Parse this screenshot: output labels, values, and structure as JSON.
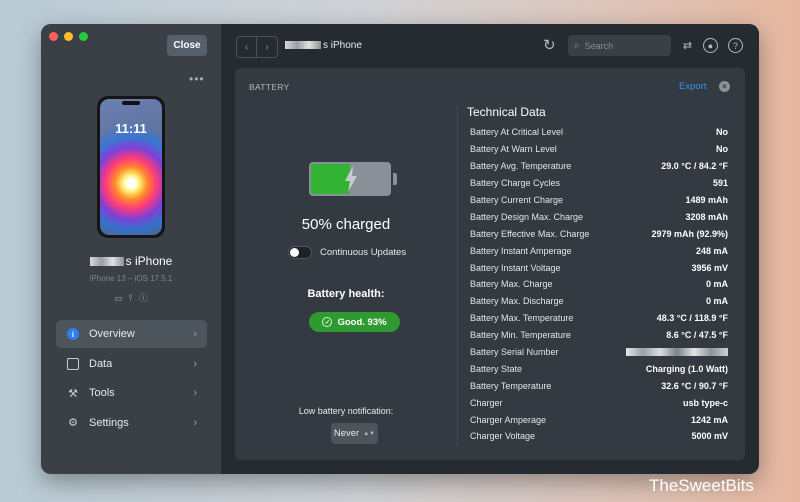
{
  "sidebar": {
    "close_label": "Close",
    "more_label": "•••",
    "device": {
      "name": "s iPhone",
      "model": "iPhone 13 – iOS 17.5.1",
      "lock_time": "11:11"
    },
    "nav": [
      {
        "label": "Overview",
        "icon": "info-icon",
        "active": true
      },
      {
        "label": "Data",
        "icon": "data-icon",
        "active": false
      },
      {
        "label": "Tools",
        "icon": "tools-icon",
        "active": false
      },
      {
        "label": "Settings",
        "icon": "gear-icon",
        "active": false
      }
    ]
  },
  "toolbar": {
    "title": "s iPhone",
    "search_placeholder": "Search"
  },
  "panel": {
    "title": "BATTERY",
    "export_label": "Export",
    "battery": {
      "level_fraction": 0.5,
      "charged_text": "50% charged",
      "continuous_updates_label": "Continuous Updates",
      "health_label": "Battery health:",
      "health_value": "Good. 93%",
      "low_battery_label": "Low battery notification:",
      "low_battery_value": "Never"
    },
    "technical": {
      "title": "Technical Data",
      "rows": [
        {
          "key": "Battery At Critical Level",
          "value": "No"
        },
        {
          "key": "Battery At Warn Level",
          "value": "No"
        },
        {
          "key": "Battery Avg. Temperature",
          "value": "29.0 °C / 84.2 °F"
        },
        {
          "key": "Battery Charge Cycles",
          "value": "591"
        },
        {
          "key": "Battery Current Charge",
          "value": "1489 mAh"
        },
        {
          "key": "Battery Design Max. Charge",
          "value": "3208 mAh"
        },
        {
          "key": "Battery Effective Max. Charge",
          "value": "2979 mAh (92.9%)"
        },
        {
          "key": "Battery Instant Amperage",
          "value": "248 mA"
        },
        {
          "key": "Battery Instant Voltage",
          "value": "3956 mV"
        },
        {
          "key": "Battery Max. Charge",
          "value": "0 mA"
        },
        {
          "key": "Battery Max. Discharge",
          "value": "0 mA"
        },
        {
          "key": "Battery Max. Temperature",
          "value": "48.3 °C / 118.9 °F"
        },
        {
          "key": "Battery Min. Temperature",
          "value": "8.6 °C / 47.5 °F"
        },
        {
          "key": "Battery Serial Number",
          "value": ""
        },
        {
          "key": "Battery State",
          "value": "Charging (1.0 Watt)"
        },
        {
          "key": "Battery Temperature",
          "value": "32.6 °C / 90.7 °F"
        },
        {
          "key": "Charger",
          "value": "usb type-c"
        },
        {
          "key": "Charger Amperage",
          "value": "1242 mA"
        },
        {
          "key": "Charger Voltage",
          "value": "5000 mV"
        }
      ]
    }
  },
  "watermark": "TheSweetBits",
  "colors": {
    "accent": "#3c8ef0",
    "battery_fill": "#33b233",
    "health_badge": "#2f9a2f",
    "traffic_red": "#fe5f57",
    "traffic_yellow": "#febc2e",
    "traffic_green": "#28c840"
  }
}
